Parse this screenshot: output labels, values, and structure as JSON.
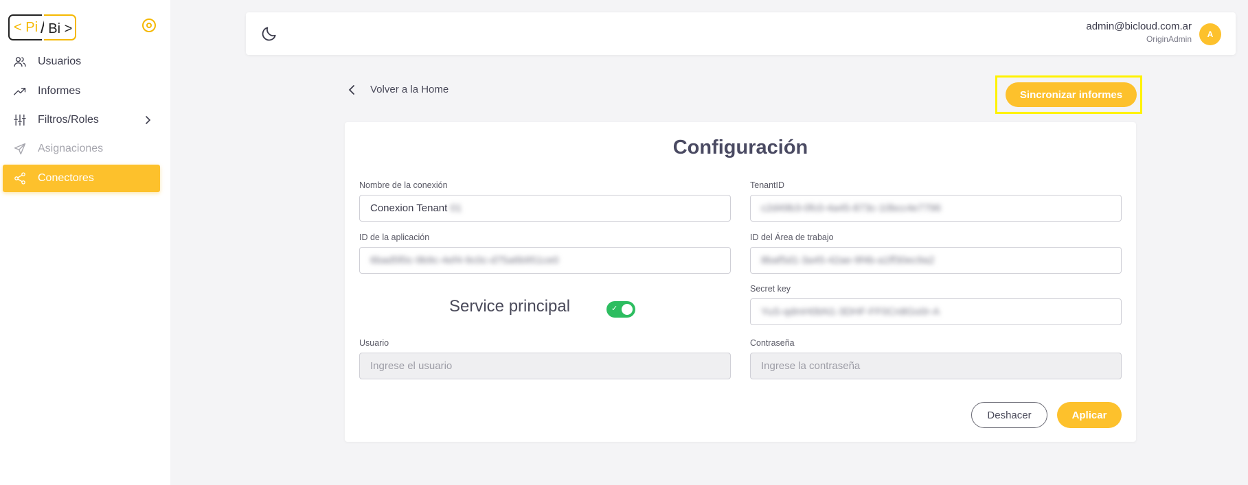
{
  "logo": {
    "left_text": "< Pi",
    "slash": "/",
    "right_text": "Bi >"
  },
  "sidebar": {
    "items": [
      {
        "label": "Usuarios",
        "icon": "users-icon",
        "state": "normal"
      },
      {
        "label": "Informes",
        "icon": "trending-up-icon",
        "state": "normal"
      },
      {
        "label": "Filtros/Roles",
        "icon": "sliders-icon",
        "state": "normal",
        "has_submenu": true
      },
      {
        "label": "Asignaciones",
        "icon": "send-icon",
        "state": "disabled"
      },
      {
        "label": "Conectores",
        "icon": "share-icon",
        "state": "active"
      }
    ]
  },
  "header": {
    "theme_icon": "moon-icon",
    "user_email": "admin@bicloud.com.ar",
    "user_role": "OriginAdmin",
    "avatar_initial": "A"
  },
  "page": {
    "back_label": "Volver a la Home",
    "sync_label": "Sincronizar informes"
  },
  "form": {
    "title": "Configuración",
    "connection_name": {
      "label": "Nombre de la conexión",
      "value_visible": "Conexion Tenant",
      "value_blurred": "01"
    },
    "tenant_id": {
      "label": "TenantID",
      "value_blurred": "c2d49b3-0fc0-4a45-873c-10bcc4e7796"
    },
    "app_id": {
      "label": "ID de la aplicación",
      "value_blurred": "6bad5f0c-9b9c-4ef4-9c0c-d75a6b951ce0"
    },
    "workspace_id": {
      "label": "ID del Área de trabajo",
      "value_blurred": "8baf5d1-3a45-42ae-9f4b-a1ff30ec9a2"
    },
    "service_principal": {
      "label": "Service principal",
      "enabled": true
    },
    "secret_key": {
      "label": "Secret key",
      "value_blurred": "YuS-qdmH0bN1-3DHF-FF0Cn8Go0r-A"
    },
    "user": {
      "label": "Usuario",
      "placeholder": "Ingrese el usuario"
    },
    "password": {
      "label": "Contraseña",
      "placeholder": "Ingrese la contraseña"
    },
    "undo_label": "Deshacer",
    "apply_label": "Aplicar"
  },
  "colors": {
    "accent": "#fdc12c",
    "toggle_on": "#2dbd60",
    "highlight_frame": "#fff200"
  }
}
